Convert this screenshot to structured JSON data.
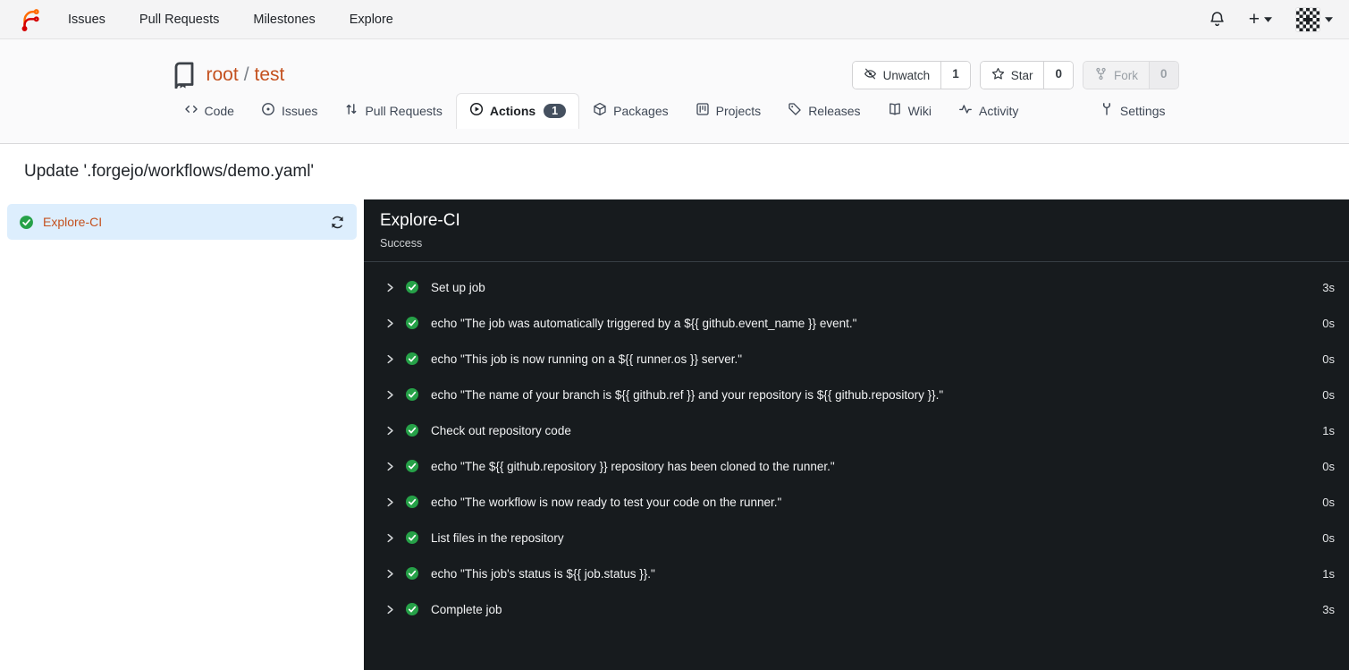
{
  "navbar": {
    "brand_icon": "forgejo-logo",
    "items": [
      {
        "label": "Issues"
      },
      {
        "label": "Pull Requests"
      },
      {
        "label": "Milestones"
      },
      {
        "label": "Explore"
      }
    ],
    "notifications_icon": "bell-icon",
    "create_icon": "plus-icon",
    "avatar_icon": "identicon-avatar"
  },
  "repo_header": {
    "icon": "repo-book-icon",
    "owner": "root",
    "separator": "/",
    "name": "test",
    "buttons": [
      {
        "label": "Unwatch",
        "count": "1",
        "icon": "eye-slash-icon",
        "disabled": false
      },
      {
        "label": "Star",
        "count": "0",
        "icon": "star-icon",
        "disabled": false
      },
      {
        "label": "Fork",
        "count": "0",
        "icon": "fork-icon",
        "disabled": true
      }
    ],
    "tabs": [
      {
        "label": "Code",
        "icon": "code-icon"
      },
      {
        "label": "Issues",
        "icon": "issue-circle-icon"
      },
      {
        "label": "Pull Requests",
        "icon": "pull-request-icon"
      },
      {
        "label": "Actions",
        "icon": "play-circle-icon",
        "badge": "1",
        "active": true
      },
      {
        "label": "Packages",
        "icon": "package-icon"
      },
      {
        "label": "Projects",
        "icon": "project-board-icon"
      },
      {
        "label": "Releases",
        "icon": "tag-icon"
      },
      {
        "label": "Wiki",
        "icon": "wiki-book-icon"
      },
      {
        "label": "Activity",
        "icon": "pulse-icon"
      }
    ],
    "settings_tab": {
      "label": "Settings",
      "icon": "settings-icon"
    }
  },
  "page": {
    "title": "Update '.forgejo/workflows/demo.yaml'"
  },
  "sidebar": {
    "jobs": [
      {
        "label": "Explore-CI",
        "status": "success",
        "selected": true,
        "rerun_icon": "refresh-icon"
      }
    ]
  },
  "panel": {
    "title": "Explore-CI",
    "status": "Success",
    "steps": [
      {
        "label": "Set up job",
        "duration": "3s",
        "status": "success"
      },
      {
        "label": "echo \"The job was automatically triggered by a ${{ github.event_name }} event.\"",
        "duration": "0s",
        "status": "success"
      },
      {
        "label": "echo \"This job is now running on a ${{ runner.os }} server.\"",
        "duration": "0s",
        "status": "success"
      },
      {
        "label": "echo \"The name of your branch is ${{ github.ref }} and your repository is ${{ github.repository }}.\"",
        "duration": "0s",
        "status": "success"
      },
      {
        "label": "Check out repository code",
        "duration": "1s",
        "status": "success"
      },
      {
        "label": "echo \"The ${{ github.repository }} repository has been cloned to the runner.\"",
        "duration": "0s",
        "status": "success"
      },
      {
        "label": "echo \"The workflow is now ready to test your code on the runner.\"",
        "duration": "0s",
        "status": "success"
      },
      {
        "label": "List files in the repository",
        "duration": "0s",
        "status": "success"
      },
      {
        "label": "echo \"This job's status is ${{ job.status }}.\"",
        "duration": "1s",
        "status": "success"
      },
      {
        "label": "Complete job",
        "duration": "3s",
        "status": "success"
      }
    ]
  },
  "colors": {
    "accent_link": "#c4511f",
    "success_green": "#26a148",
    "panel_bg": "#171b1e",
    "selected_job_bg": "#ddeefd",
    "badge_bg": "#45505f",
    "navbar_bg": "#f4f4f5"
  }
}
